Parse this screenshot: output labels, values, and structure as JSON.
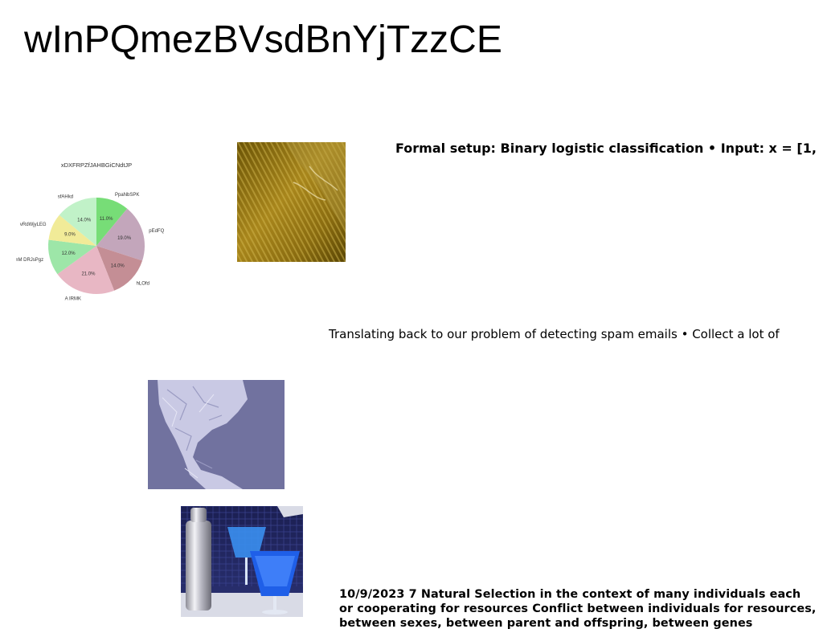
{
  "slide": {
    "title": "wInPQmezBVsdBnYjTzzCE",
    "formal_setup_text": "Formal setup: Binary logistic classification • Input: x = [1,",
    "translating_text": "Translating back to our problem of detecting spam emails • Collect a lot of",
    "natural_selection_lines": [
      "10/9/2023 7 Natural Selection in the context of many individuals each",
      "or cooperating for resources Conflict between individuals for resources,",
      "between sexes, between parent and offspring, between genes"
    ]
  },
  "images": {
    "gold": "gold-wave-texture-photo",
    "paper": "crumpled-paper-photo",
    "drinks": "blue-cocktails-photo"
  },
  "chart_data": {
    "type": "pie",
    "title": "xDXFRPZfJAHBGiCNdtJP",
    "labels": [
      "PpaNbSPK",
      "pEdFQ",
      "hLOfd",
      "A IRMK",
      "mM DRJsPgz",
      "vRdWjyLEG",
      "sfAHkd"
    ],
    "values": [
      11.0,
      19.0,
      14.0,
      21.0,
      12.0,
      9.0,
      14.0
    ],
    "value_labels": [
      "11.0%",
      "19.0%",
      "14.0%",
      "21.0%",
      "12.0%",
      "9.0%",
      "14.0%"
    ],
    "colors": [
      "#77dd77",
      "#c3a6bb",
      "#c48e95",
      "#e8b7c4",
      "#9de6a8",
      "#f1eb98",
      "#c1f2c8"
    ],
    "start_angle": "top, clockwise",
    "legend": "none"
  }
}
